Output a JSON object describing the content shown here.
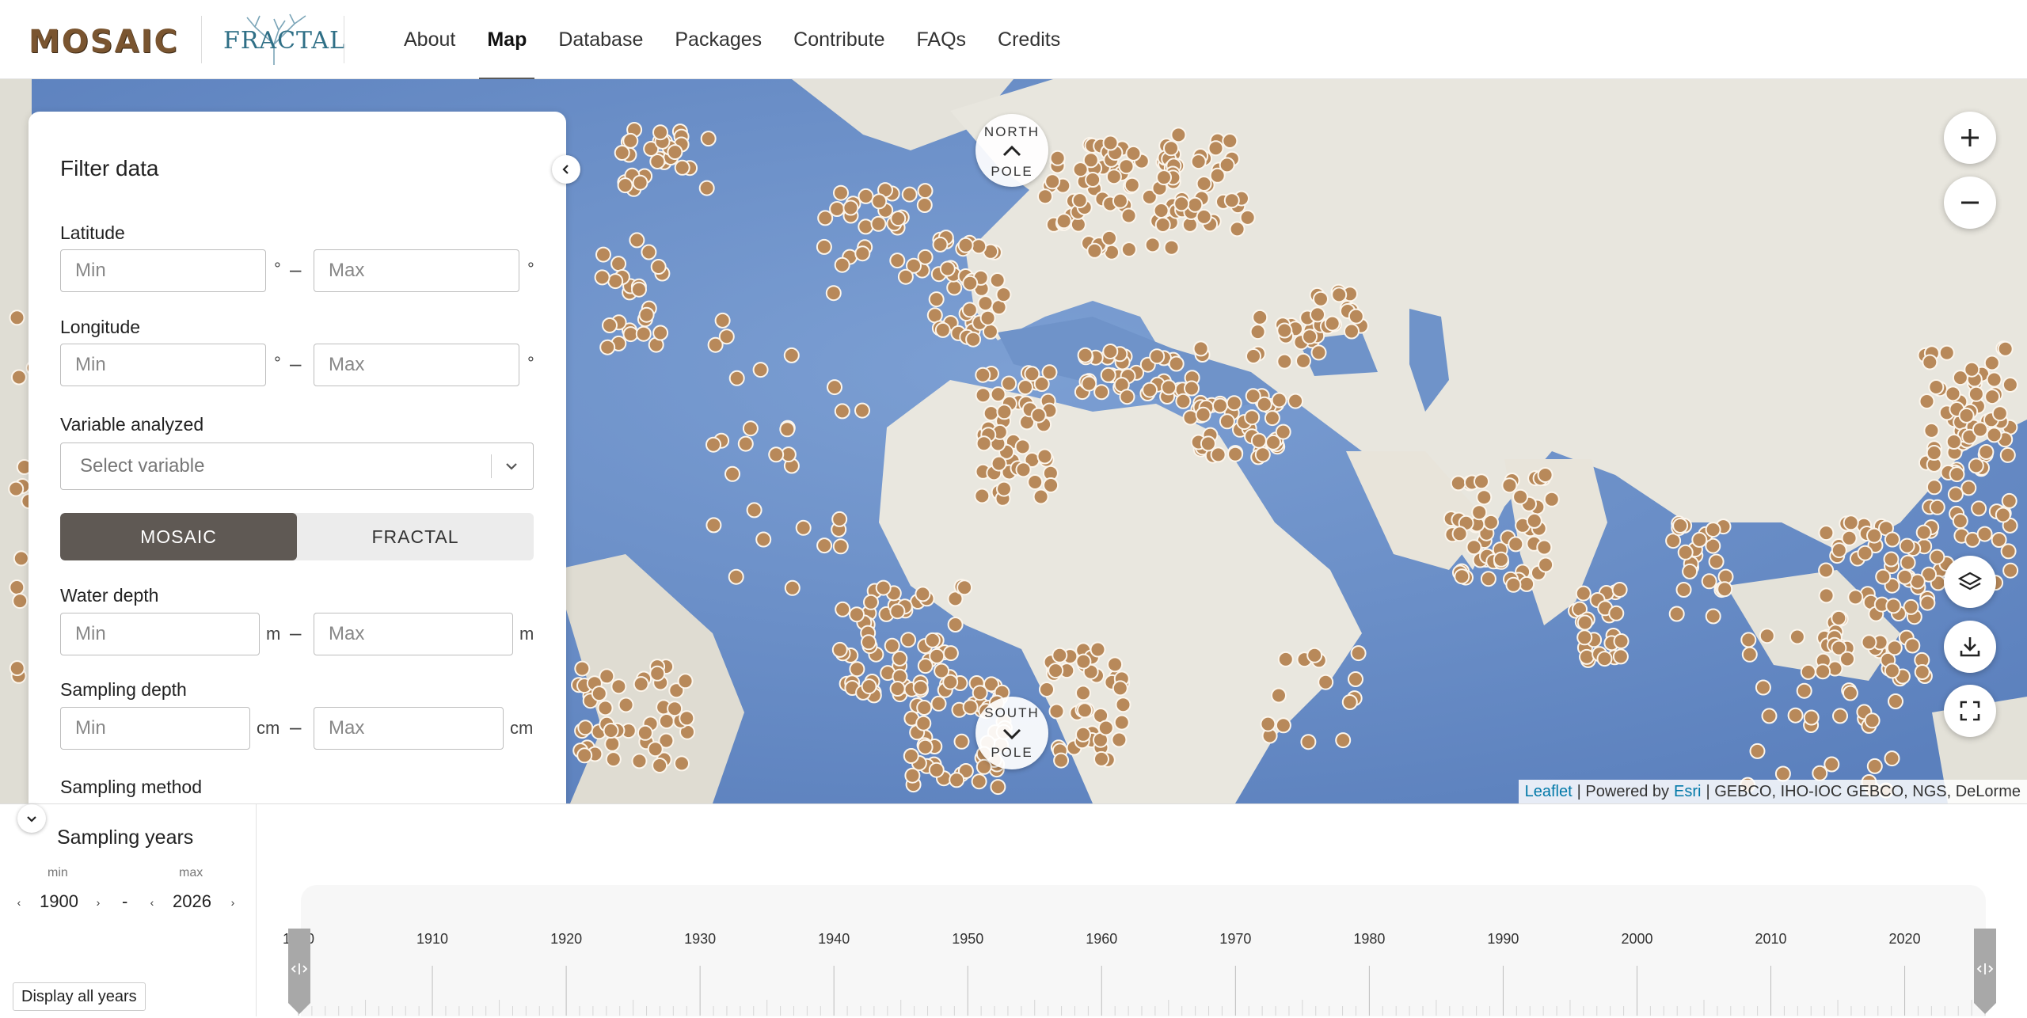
{
  "header": {
    "logo_text": "MOSAIC",
    "logo2_text": "FRACTAL",
    "nav": [
      {
        "label": "About"
      },
      {
        "label": "Map",
        "active": true
      },
      {
        "label": "Database"
      },
      {
        "label": "Packages"
      },
      {
        "label": "Contribute"
      },
      {
        "label": "FAQs"
      },
      {
        "label": "Credits"
      }
    ]
  },
  "map": {
    "north_pole_label_1": "NORTH",
    "north_pole_label_2": "POLE",
    "south_pole_label_1": "SOUTH",
    "south_pole_label_2": "POLE",
    "controls": [
      "zoom-in-icon",
      "zoom-out-icon",
      "layers-icon",
      "download-icon",
      "fullscreen-icon"
    ],
    "attribution": {
      "leaflet": "Leaflet",
      "powered": "| Powered by",
      "esri": "Esri",
      "rest": "| GEBCO, IHO-IOC GEBCO, NGS, DeLorme"
    },
    "colors": {
      "ocean": "#6a8fc7",
      "land": "#e8e6de",
      "site": "#b8895a",
      "site_stroke": "#ffffff"
    }
  },
  "filter": {
    "title": "Filter data",
    "latitude": {
      "label": "Latitude",
      "min_placeholder": "Min",
      "max_placeholder": "Max",
      "unit": "°"
    },
    "longitude": {
      "label": "Longitude",
      "min_placeholder": "Min",
      "max_placeholder": "Max",
      "unit": "°"
    },
    "variable": {
      "label": "Variable analyzed",
      "placeholder": "Select variable"
    },
    "toggle": {
      "option1": "MOSAIC",
      "option2": "FRACTAL",
      "active": "MOSAIC"
    },
    "water_depth": {
      "label": "Water depth",
      "min_placeholder": "Min",
      "max_placeholder": "Max",
      "unit": "m"
    },
    "sampling_depth": {
      "label": "Sampling depth",
      "min_placeholder": "Min",
      "max_placeholder": "Max",
      "unit": "cm"
    },
    "sampling_method": {
      "label": "Sampling method"
    },
    "dash": "–"
  },
  "years": {
    "title": "Sampling years",
    "min_label": "min",
    "max_label": "max",
    "min_value": "1900",
    "max_value": "2026",
    "separator": "-",
    "display_all": "Display all years",
    "ticks": [
      "1900",
      "1910",
      "1920",
      "1930",
      "1940",
      "1950",
      "1960",
      "1970",
      "1980",
      "1990",
      "2000",
      "2010",
      "2020"
    ],
    "range": [
      1900,
      2026
    ]
  }
}
